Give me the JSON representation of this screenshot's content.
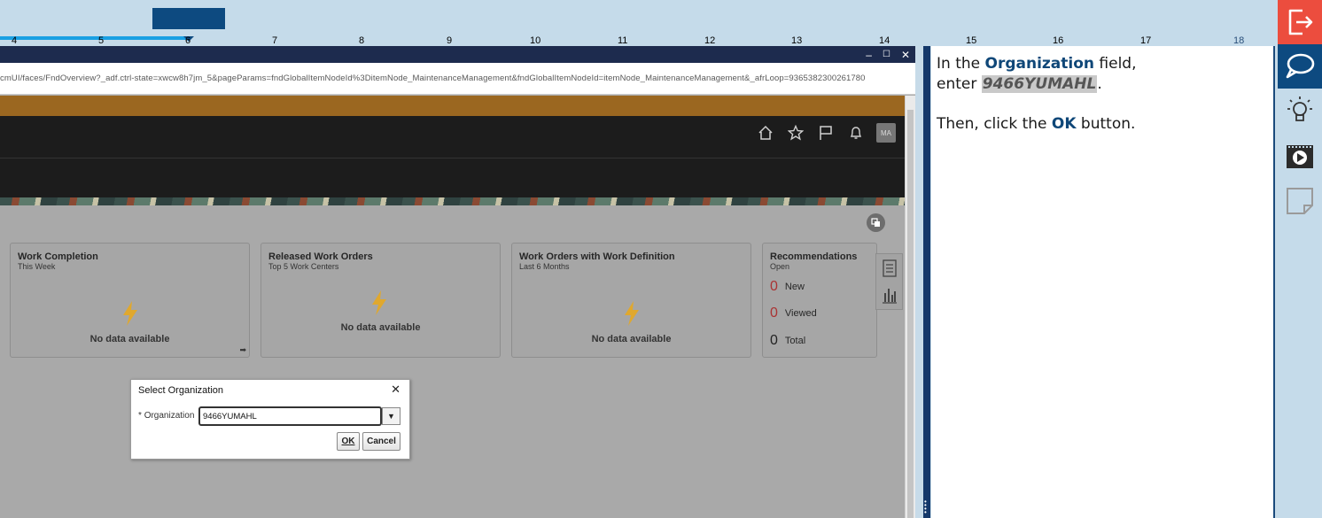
{
  "ruler": {
    "ticks": [
      "4",
      "5",
      "6",
      "7",
      "8",
      "9",
      "10",
      "11",
      "12",
      "13",
      "14",
      "15",
      "16",
      "17",
      "18"
    ]
  },
  "browser": {
    "url": "cmUI/faces/FndOverview?_adf.ctrl-state=xwcw8h7jm_5&pageParams=fndGlobalItemNodeId%3DitemNode_MaintenanceManagement&fndGlobalItemNodeId=itemNode_MaintenanceManagement&_afrLoop=9365382300261780",
    "controls": [
      "–",
      "☐",
      "✕"
    ]
  },
  "header": {
    "avatar_initials": "MA",
    "icons": [
      "home-icon",
      "favorites-star-icon",
      "flag-icon",
      "notifications-bell-icon"
    ]
  },
  "cards": [
    {
      "title": "Work Completion",
      "subtitle": "This Week",
      "empty_text": "No data available"
    },
    {
      "title": "Released Work Orders",
      "subtitle": "Top 5 Work Centers",
      "empty_text": "No data available"
    },
    {
      "title": "Work Orders with Work Definition",
      "subtitle": "Last 6 Months",
      "empty_text": "No data available"
    }
  ],
  "recommendations": {
    "title": "Recommendations",
    "subtitle": "Open",
    "rows": [
      {
        "count": "0",
        "label": "New"
      },
      {
        "count": "0",
        "label": "Viewed"
      },
      {
        "count": "0",
        "label": "Total"
      }
    ]
  },
  "dialog": {
    "title": "Select Organization",
    "close_glyph": "✕",
    "required_marker": "*",
    "field_label": "Organization",
    "field_value": "9466YUMAHL",
    "ok_label": "OK",
    "cancel_label": "Cancel"
  },
  "instruction": {
    "line1_prefix": "In the ",
    "field_name": "Organization",
    "line1_suffix": " field,",
    "line2_prefix": "enter ",
    "typed_value": "9466YUMAHL",
    "line2_suffix": ".",
    "line3_prefix": "Then, click the ",
    "button_name": "OK",
    "line3_suffix": " button."
  },
  "colors": {
    "accent_dark_blue": "#0d4a80",
    "exit_red": "#ec4d3e",
    "oracle_orange": "#9b6720",
    "bolt_yellow": "#e0a82e"
  }
}
